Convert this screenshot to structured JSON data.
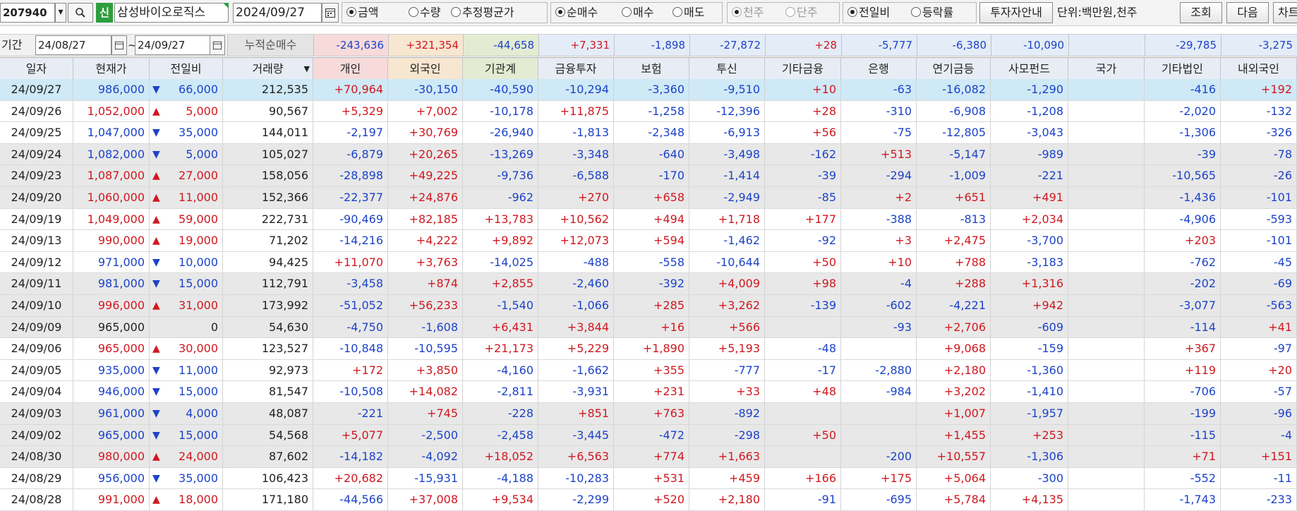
{
  "toolbar": {
    "code": "207940",
    "badge": "신",
    "name": "삼성바이오로직스",
    "date": "2024/09/27",
    "group1": [
      {
        "label": "금액",
        "on": true
      },
      {
        "label": "수량",
        "on": false
      },
      {
        "label": "추정평균가",
        "on": false
      }
    ],
    "group2": [
      {
        "label": "순매수",
        "on": true
      },
      {
        "label": "매수",
        "on": false
      },
      {
        "label": "매도",
        "on": false
      }
    ],
    "group3": [
      {
        "label": "천주",
        "on": true
      },
      {
        "label": "단주",
        "on": false
      }
    ],
    "group4": [
      {
        "label": "전일비",
        "on": true
      },
      {
        "label": "등락률",
        "on": false
      }
    ],
    "info_button": "투자자안내",
    "unit": "단위:백만원,천주",
    "query_button": "조회",
    "next_button": "다음",
    "chart_button": "차트"
  },
  "period": {
    "label": "기간",
    "from": "24/08/27",
    "tilde": "~",
    "to": "24/09/27",
    "cum_label": "누적순매수",
    "cum_values": [
      "-243,636",
      "+321,354",
      "-44,658",
      "+7,331",
      "-1,898",
      "-27,872",
      "+28",
      "-5,777",
      "-6,380",
      "-10,090",
      "",
      "-29,785",
      "-3,275"
    ]
  },
  "columns": [
    "일자",
    "현재가",
    "전일비",
    "거래량",
    "개인",
    "외국인",
    "기관계",
    "금융투자",
    "보험",
    "투신",
    "기타금융",
    "은행",
    "연기금등",
    "사모펀드",
    "국가",
    "기타법인",
    "내외국인"
  ],
  "rows": [
    [
      "24/09/27",
      "986,000",
      "dn",
      "66,000",
      "212,535",
      "+70,964",
      "-30,150",
      "-40,590",
      "-10,294",
      "-3,360",
      "-9,510",
      "+10",
      "-63",
      "-16,082",
      "-1,290",
      "",
      "-416",
      "+192"
    ],
    [
      "24/09/26",
      "1,052,000",
      "up",
      "5,000",
      "90,567",
      "+5,329",
      "+7,002",
      "-10,178",
      "+11,875",
      "-1,258",
      "-12,396",
      "+28",
      "-310",
      "-6,908",
      "-1,208",
      "",
      "-2,020",
      "-132"
    ],
    [
      "24/09/25",
      "1,047,000",
      "dn",
      "35,000",
      "144,011",
      "-2,197",
      "+30,769",
      "-26,940",
      "-1,813",
      "-2,348",
      "-6,913",
      "+56",
      "-75",
      "-12,805",
      "-3,043",
      "",
      "-1,306",
      "-326"
    ],
    [
      "24/09/24",
      "1,082,000",
      "dn",
      "5,000",
      "105,027",
      "-6,879",
      "+20,265",
      "-13,269",
      "-3,348",
      "-640",
      "-3,498",
      "-162",
      "+513",
      "-5,147",
      "-989",
      "",
      "-39",
      "-78"
    ],
    [
      "24/09/23",
      "1,087,000",
      "up",
      "27,000",
      "158,056",
      "-28,898",
      "+49,225",
      "-9,736",
      "-6,588",
      "-170",
      "-1,414",
      "-39",
      "-294",
      "-1,009",
      "-221",
      "",
      "-10,565",
      "-26"
    ],
    [
      "24/09/20",
      "1,060,000",
      "up",
      "11,000",
      "152,366",
      "-22,377",
      "+24,876",
      "-962",
      "+270",
      "+658",
      "-2,949",
      "-85",
      "+2",
      "+651",
      "+491",
      "",
      "-1,436",
      "-101"
    ],
    [
      "24/09/19",
      "1,049,000",
      "up",
      "59,000",
      "222,731",
      "-90,469",
      "+82,185",
      "+13,783",
      "+10,562",
      "+494",
      "+1,718",
      "+177",
      "-388",
      "-813",
      "+2,034",
      "",
      "-4,906",
      "-593"
    ],
    [
      "24/09/13",
      "990,000",
      "up",
      "19,000",
      "71,202",
      "-14,216",
      "+4,222",
      "+9,892",
      "+12,073",
      "+594",
      "-1,462",
      "-92",
      "+3",
      "+2,475",
      "-3,700",
      "",
      "+203",
      "-101"
    ],
    [
      "24/09/12",
      "971,000",
      "dn",
      "10,000",
      "94,425",
      "+11,070",
      "+3,763",
      "-14,025",
      "-488",
      "-558",
      "-10,644",
      "+50",
      "+10",
      "+788",
      "-3,183",
      "",
      "-762",
      "-45"
    ],
    [
      "24/09/11",
      "981,000",
      "dn",
      "15,000",
      "112,791",
      "-3,458",
      "+874",
      "+2,855",
      "-2,460",
      "-392",
      "+4,009",
      "+98",
      "-4",
      "+288",
      "+1,316",
      "",
      "-202",
      "-69"
    ],
    [
      "24/09/10",
      "996,000",
      "up",
      "31,000",
      "173,992",
      "-51,052",
      "+56,233",
      "-1,540",
      "-1,066",
      "+285",
      "+3,262",
      "-139",
      "-602",
      "-4,221",
      "+942",
      "",
      "-3,077",
      "-563"
    ],
    [
      "24/09/09",
      "965,000",
      "",
      "0",
      "54,630",
      "-4,750",
      "-1,608",
      "+6,431",
      "+3,844",
      "+16",
      "+566",
      "",
      "-93",
      "+2,706",
      "-609",
      "",
      "-114",
      "+41"
    ],
    [
      "24/09/06",
      "965,000",
      "up",
      "30,000",
      "123,527",
      "-10,848",
      "-10,595",
      "+21,173",
      "+5,229",
      "+1,890",
      "+5,193",
      "-48",
      "",
      "+9,068",
      "-159",
      "",
      "+367",
      "-97"
    ],
    [
      "24/09/05",
      "935,000",
      "dn",
      "11,000",
      "92,973",
      "+172",
      "+3,850",
      "-4,160",
      "-1,662",
      "+355",
      "-777",
      "-17",
      "-2,880",
      "+2,180",
      "-1,360",
      "",
      "+119",
      "+20"
    ],
    [
      "24/09/04",
      "946,000",
      "dn",
      "15,000",
      "81,547",
      "-10,508",
      "+14,082",
      "-2,811",
      "-3,931",
      "+231",
      "+33",
      "+48",
      "-984",
      "+3,202",
      "-1,410",
      "",
      "-706",
      "-57"
    ],
    [
      "24/09/03",
      "961,000",
      "dn",
      "4,000",
      "48,087",
      "-221",
      "+745",
      "-228",
      "+851",
      "+763",
      "-892",
      "",
      "",
      "+1,007",
      "-1,957",
      "",
      "-199",
      "-96"
    ],
    [
      "24/09/02",
      "965,000",
      "dn",
      "15,000",
      "54,568",
      "+5,077",
      "-2,500",
      "-2,458",
      "-3,445",
      "-472",
      "-298",
      "+50",
      "",
      "+1,455",
      "+253",
      "",
      "-115",
      "-4"
    ],
    [
      "24/08/30",
      "980,000",
      "up",
      "24,000",
      "87,602",
      "-14,182",
      "-4,092",
      "+18,052",
      "+6,563",
      "+774",
      "+1,663",
      "",
      "-200",
      "+10,557",
      "-1,306",
      "",
      "+71",
      "+151"
    ],
    [
      "24/08/29",
      "956,000",
      "dn",
      "35,000",
      "106,423",
      "+20,682",
      "-15,931",
      "-4,188",
      "-10,283",
      "+531",
      "+459",
      "+166",
      "+175",
      "+5,064",
      "-300",
      "",
      "-552",
      "-11"
    ],
    [
      "24/08/28",
      "991,000",
      "up",
      "18,000",
      "171,180",
      "-44,566",
      "+37,008",
      "+9,534",
      "-2,299",
      "+520",
      "+2,180",
      "-91",
      "-695",
      "+5,784",
      "+4,135",
      "",
      "-1,743",
      "-233"
    ]
  ],
  "colors": {
    "up": "#d0181f",
    "down": "#1c43c8",
    "row_gray": "#e8e8e8",
    "row_selected": "#cfe9f6",
    "header_bg": "#e8edf5",
    "personal_hdr": "#f7dada",
    "foreign_hdr": "#f7e6d0",
    "inst_hdr": "#e3ecd2"
  }
}
